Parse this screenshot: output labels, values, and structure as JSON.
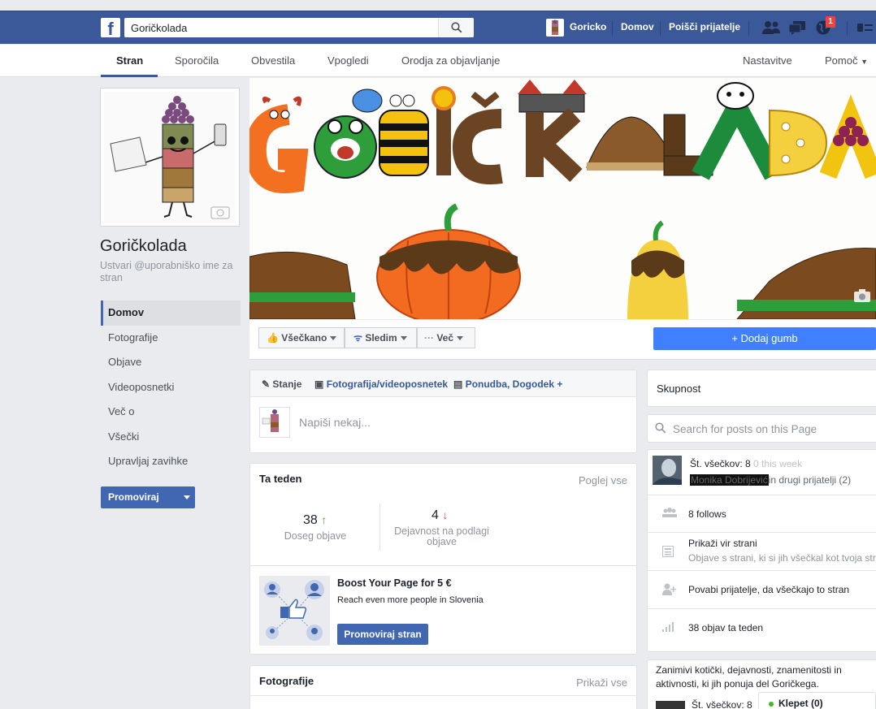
{
  "topbar": {
    "search_value": "Goričkolada",
    "profile_name": "Goricko",
    "home_label": "Domov",
    "find_friends_label": "Poišči prijatelje",
    "notifications_count": "1"
  },
  "page_nav": {
    "tabs": [
      "Stran",
      "Sporočila",
      "Obvestila",
      "Vpogledi",
      "Orodja za objavljanje"
    ],
    "settings_label": "Nastavitve",
    "help_label": "Pomoč"
  },
  "page": {
    "name": "Goričkolada",
    "username_prompt": "Ustvari @uporabniško ime za stran"
  },
  "left_nav": {
    "items": [
      "Domov",
      "Fotografije",
      "Objave",
      "Videoposnetki",
      "Več o",
      "Všečki",
      "Upravljaj zavihke"
    ],
    "promote_label": "Promoviraj"
  },
  "cover": {
    "title_art": "GORIČKOLADA"
  },
  "actions": {
    "liked_label": "Všečkano",
    "following_label": "Sledim",
    "more_label": "Več",
    "add_button_label": "+ Dodaj gumb"
  },
  "composer": {
    "tab_status": "Stanje",
    "tab_photo": "Fotografija/videoposnetek",
    "tab_offer": "Ponudba, Dogodek +",
    "placeholder": "Napiši nekaj..."
  },
  "this_week": {
    "title": "Ta teden",
    "see_all": "Poglej vse",
    "reach_value": "38",
    "reach_label": "Doseg objave",
    "engagement_value": "4",
    "engagement_label": "Dejavnost na podlagi objave",
    "boost_title": "Boost Your Page for 5 €",
    "boost_subtitle": "Reach even more people in Slovenia",
    "boost_button": "Promoviraj stran"
  },
  "photos": {
    "title": "Fotografije",
    "see_all": "Prikaži vse"
  },
  "community": {
    "title": "Skupnost",
    "search_placeholder": "Search for posts on this Page"
  },
  "stats": {
    "likes_label": "Št. všečkov: 8",
    "likes_week": "0 this week",
    "friend_name": "Monika Dobrijević",
    "friend_suffix": "in drugi prijatelji (2)",
    "follows": "8 follows",
    "view_source": "Prikaži vir strani",
    "view_source_sub": "Objave s strani, ki si jih všečkal kot tvoja stran",
    "invite": "Povabi prijatelje, da všečkajo to stran",
    "posts_week": "38 objav ta teden"
  },
  "about": {
    "text": "Zanimivi kotički, dejavnosti, znamenitosti in aktivnosti, ki jih ponuja del Goričkega.",
    "likes_label": "Št. všečkov: 8"
  },
  "chat": {
    "label": "Klepet (0)"
  },
  "colors": {
    "fb_blue": "#3b5998",
    "button_blue": "#4267b2",
    "add_button": "#4080ff",
    "up_arrow": "#42b72a",
    "down_arrow": "#fa3e3e"
  }
}
